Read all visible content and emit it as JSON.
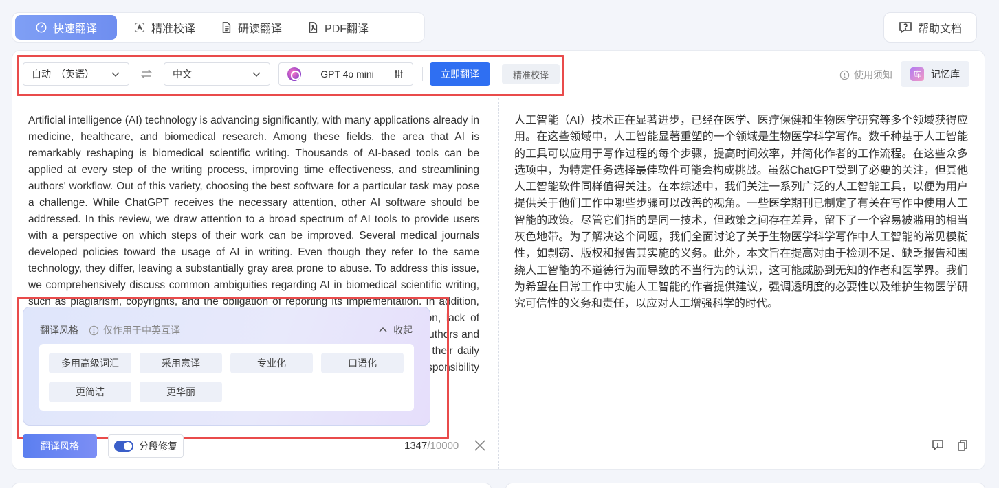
{
  "tabs": [
    {
      "label": "快速翻译",
      "icon": "gauge-icon",
      "active": true
    },
    {
      "label": "精准校译",
      "icon": "scan-text-icon",
      "active": false
    },
    {
      "label": "研读翻译",
      "icon": "document-icon",
      "active": false
    },
    {
      "label": "PDF翻译",
      "icon": "pdf-icon",
      "active": false
    }
  ],
  "help": {
    "label": "帮助文档"
  },
  "toolbar": {
    "source_lang": "自动　（英语）",
    "target_lang": "中文",
    "model": "GPT 4o mini",
    "translate_btn": "立即翻译",
    "proof_btn": "精准校译"
  },
  "right_toolbar": {
    "notice": "使用须知",
    "memory_icon_text": "库",
    "memory": "记忆库"
  },
  "source_text": "Artificial intelligence (AI) technology is advancing significantly, with many applications already in medicine, healthcare, and biomedical research. Among these fields, the area that AI is remarkably reshaping is biomedical scientific writing. Thousands of AI-based tools can be applied at every step of the writing process, improving time effectiveness, and streamlining authors' workflow. Out of this variety, choosing the best software for a particular task may pose a challenge. While ChatGPT receives the necessary attention, other AI software should be addressed. In this review, we draw attention to a broad spectrum of AI tools to provide users with a perspective on which steps of their work can be improved. Several medical journals developed policies toward the usage of AI in writing. Even though they refer to the same technology, they differ, leaving a substantially gray area prone to abuse. To address this issue, we comprehensively discuss common ambiguities regarding AI in biomedical scientific writing, such as plagiarism, copyrights, and the obligation of reporting its implementation. In addition, this article aims to raise awareness about misconduct due to insufficient detection, lack of reporting, and unethical practices revolving around AI that might threaten unaware authors and medical society. We provide advice for authors who would like to implement AI in their daily work, emphasizing the need for transparency and the obligation together with the responsibility to maintain biomedical research credibility in the age of artificially enhanced science.",
  "target_text": "人工智能（AI）技术正在显著进步，已经在医学、医疗保健和生物医学研究等多个领域获得应用。在这些领域中，人工智能显著重塑的一个领域是生物医学科学写作。数千种基于人工智能的工具可以应用于写作过程的每个步骤，提高时间效率，并简化作者的工作流程。在这些众多选项中，为特定任务选择最佳软件可能会构成挑战。虽然ChatGPT受到了必要的关注，但其他人工智能软件同样值得关注。在本综述中，我们关注一系列广泛的人工智能工具，以便为用户提供关于他们工作中哪些步骤可以改善的视角。一些医学期刊已制定了有关在写作中使用人工智能的政策。尽管它们指的是同一技术，但政策之间存在差异，留下了一个容易被滥用的相当灰色地带。为了解决这个问题，我们全面讨论了关于生物医学科学写作中人工智能的常见模糊性，如剽窃、版权和报告其实施的义务。此外，本文旨在提高对由于检测不足、缺乏报告和围绕人工智能的不道德行为而导致的不当行为的认识，这可能威胁到无知的作者和医学界。我们为希望在日常工作中实施人工智能的作者提供建议，强调透明度的必要性以及维护生物医学研究可信性的义务和责任，以应对人工增强科学的时代。",
  "style_popup": {
    "title": "翻译风格",
    "hint": "仅作用于中英互译",
    "collapse": "收起",
    "chips": [
      "多用高级词汇",
      "采用意译",
      "专业化",
      "口语化",
      "更简洁",
      "更华丽"
    ]
  },
  "bottom": {
    "style_btn": "翻译风格",
    "segment_fix": "分段修复",
    "count": "1347",
    "max": "/10000"
  },
  "colors": {
    "primary": "#2f6ff2",
    "highlight_box": "#e94b4b"
  }
}
